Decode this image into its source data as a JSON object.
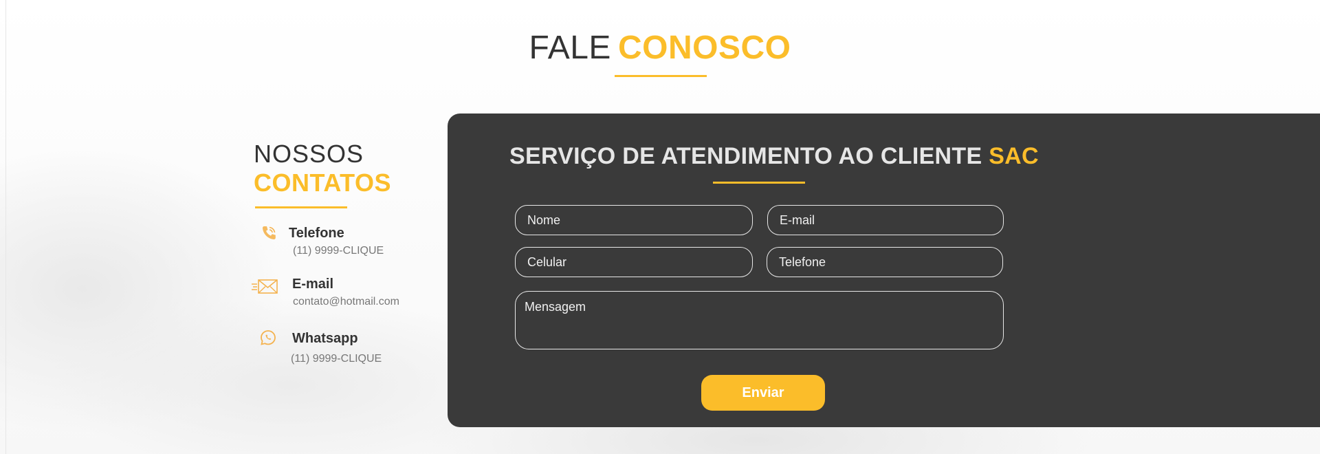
{
  "header": {
    "title_part1": "FALE",
    "title_part2": "CONOSCO"
  },
  "contacts": {
    "title_part1": "NOSSOS",
    "title_part2": "CONTATOS",
    "items": [
      {
        "icon": "phone-icon",
        "label": "Telefone",
        "value": "(11) 9999-CLIQUE"
      },
      {
        "icon": "envelope-icon",
        "label": "E-mail",
        "value": "contato@hotmail.com"
      },
      {
        "icon": "whatsapp-icon",
        "label": "Whatsapp",
        "value": "(11) 9999-CLIQUE"
      }
    ]
  },
  "form": {
    "title": "SERVIÇO DE ATENDIMENTO AO CLIENTE",
    "title_highlight": "SAC",
    "fields": {
      "name_placeholder": "Nome",
      "email_placeholder": "E-mail",
      "cell_placeholder": "Celular",
      "phone_placeholder": "Telefone",
      "message_placeholder": "Mensagem"
    },
    "submit_label": "Enviar"
  },
  "colors": {
    "accent": "#fbbd2a",
    "panel": "#3a3a3a",
    "heading": "#333333",
    "muted_text": "#777777"
  }
}
